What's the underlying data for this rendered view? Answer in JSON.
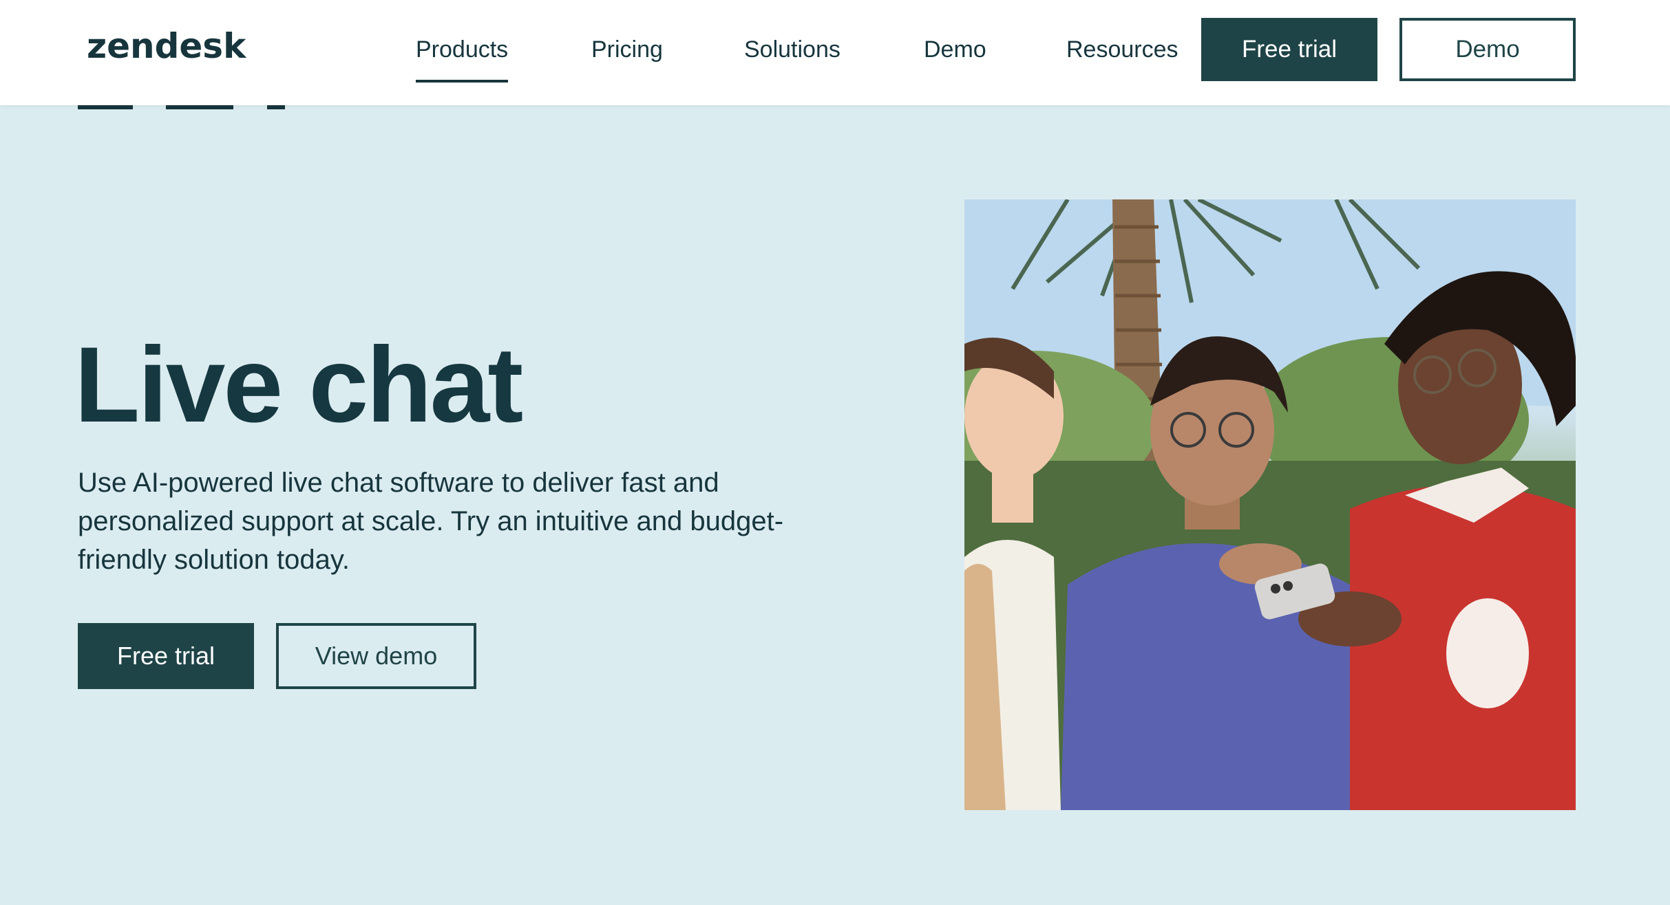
{
  "header": {
    "logo_text": "zendesk",
    "nav": [
      {
        "label": "Products",
        "active": true
      },
      {
        "label": "Pricing",
        "active": false
      },
      {
        "label": "Solutions",
        "active": false
      },
      {
        "label": "Demo",
        "active": false
      },
      {
        "label": "Resources",
        "active": false
      }
    ],
    "free_trial_label": "Free trial",
    "demo_label": "Demo"
  },
  "hero": {
    "title": "Live chat",
    "description": "Use AI-powered live chat software to deliver fast and personalized support at scale. Try an intuitive and budget-friendly solution today.",
    "free_trial_label": "Free trial",
    "view_demo_label": "View demo"
  },
  "photo": {
    "subject": "three-people-looking-at-phone-photo"
  },
  "colors": {
    "brand_dark": "#1f4447",
    "background": "#dbecf0",
    "text": "#17353d"
  }
}
